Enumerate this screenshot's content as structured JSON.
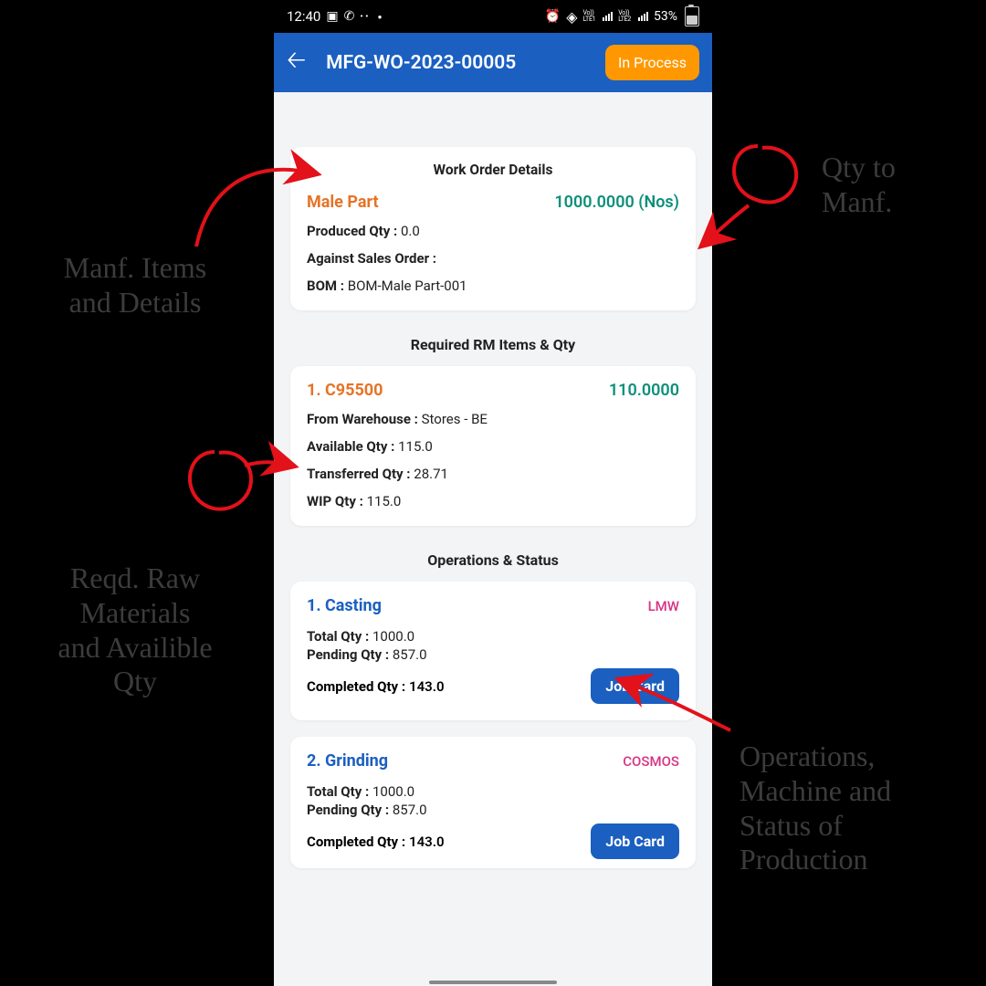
{
  "statusbar": {
    "time": "12:40",
    "battery_pct": "53%",
    "sim1": "LTE1",
    "sim2": "LTE2"
  },
  "appbar": {
    "title": "MFG-WO-2023-00005",
    "status": "In Process"
  },
  "wo": {
    "header": "Work Order Details",
    "item_name": "Male Part",
    "qty_display": "1000.0000 (Nos)",
    "produced_label": "Produced Qty :",
    "produced_value": "0.0",
    "sales_order_label": "Against Sales Order :",
    "sales_order_value": "",
    "bom_label": "BOM :",
    "bom_value": "BOM-Male Part-001"
  },
  "rm": {
    "header": "Required RM Items & Qty",
    "items": [
      {
        "title": "1. C95500",
        "qty": "110.0000",
        "from_wh_label": "From Warehouse :",
        "from_wh_value": "Stores - BE",
        "avail_label": "Available Qty :",
        "avail_value": "115.0",
        "trans_label": "Transferred Qty :",
        "trans_value": "28.71",
        "wip_label": "WIP Qty :",
        "wip_value": "115.0"
      }
    ]
  },
  "ops": {
    "header": "Operations & Status",
    "jobcard_label": "Job Card",
    "items": [
      {
        "title": "1. Casting",
        "machine": "LMW",
        "total_label": "Total Qty :",
        "total": "1000.0",
        "pending_label": "Pending Qty :",
        "pending": "857.0",
        "completed_label": "Completed Qty :",
        "completed": "143.0"
      },
      {
        "title": "2. Grinding",
        "machine": "COSMOS",
        "total_label": "Total Qty :",
        "total": "1000.0",
        "pending_label": "Pending Qty :",
        "pending": "857.0",
        "completed_label": "Completed Qty :",
        "completed": "143.0"
      }
    ]
  },
  "annotations": {
    "a1": "Manf. Items\nand Details",
    "a2": "Qty to\nManf.",
    "a3": "Reqd. Raw\nMaterials\nand Availible\nQty",
    "a4": "Operations,\nMachine and\nStatus of\nProduction"
  }
}
